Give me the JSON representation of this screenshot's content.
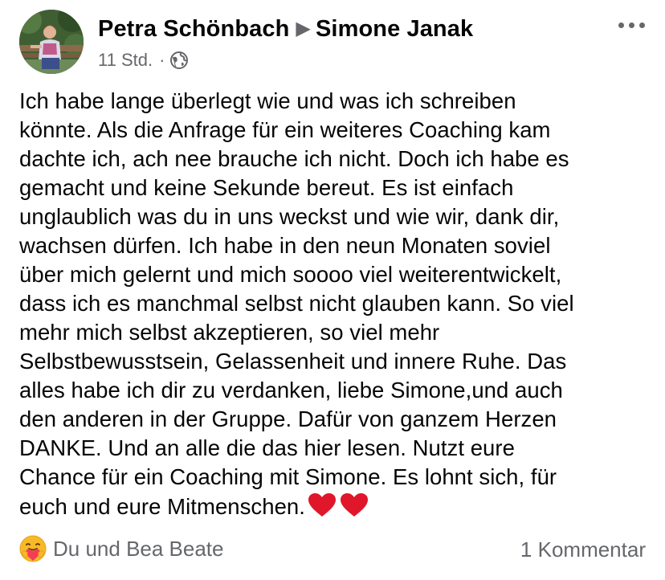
{
  "post": {
    "author": "Petra Schönbach",
    "target": "Simone Janak",
    "time": "11 Std.",
    "separator": "·",
    "audience_icon": "globe-icon",
    "body_lines": [
      "Ich habe lange überlegt wie und was ich schreiben",
      "könnte. Als die Anfrage für ein weiteres Coaching kam",
      "dachte ich, ach nee brauche ich nicht. Doch ich habe es",
      "gemacht und keine Sekunde bereut. Es ist einfach",
      "unglaublich was du in uns weckst und wie wir, dank dir,",
      "wachsen dürfen. Ich habe in den neun Monaten soviel",
      "über mich gelernt und mich soooo viel weiterentwickelt,",
      "dass ich es manchmal selbst nicht glauben kann. So viel",
      "mehr mich selbst akzeptieren, so viel mehr",
      "Selbstbewusstsein, Gelassenheit und innere Ruhe. Das",
      "alles habe ich dir zu verdanken, liebe Simone,und auch",
      "den anderen in der Gruppe. Dafür von ganzem Herzen",
      "DANKE. Und an alle die das hier lesen. Nutzt eure",
      "Chance für ein Coaching mit Simone. Es lohnt sich, für",
      "euch und eure Mitmenschen."
    ],
    "trailing_emoji": "heart-heart",
    "reactions_icon": "care-reaction-icon",
    "reactions_text": "Du und Bea Beate",
    "comments_text": "1 Kommentar"
  },
  "colors": {
    "text": "#050505",
    "secondary": "#65676b",
    "heart": "#e0162b",
    "care_face": "#f7b928"
  }
}
